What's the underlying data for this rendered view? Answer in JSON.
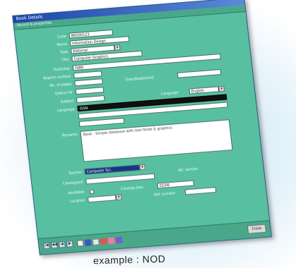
{
  "window": {
    "title": "Book Details",
    "menu_label": "Record & properties"
  },
  "form": {
    "fields": [
      {
        "label": "Code",
        "value": "BK000123"
      },
      {
        "label": "Name",
        "value": "Information Design"
      },
      {
        "label": "Type",
        "value": "Editorial"
      },
      {
        "label": "Title",
        "value": "Computer Graphics"
      },
      {
        "label": "Publisher",
        "value": "ISBN"
      },
      {
        "label": "Reprint number",
        "value": ""
      },
      {
        "label": "No. of pages",
        "value": ""
      },
      {
        "label": "Edition Nr",
        "value": ""
      },
      {
        "label": "Subject",
        "value": ""
      },
      {
        "label": "Language",
        "value": ""
      }
    ],
    "right_labels": {
      "date_label": "Date/Registered",
      "lang_label": "Language",
      "lang_value": "English"
    },
    "dark_field_value": "ISSN",
    "notes_label": "Remarks",
    "notes_value": "Book - Simple database with text fields & graphics",
    "section_label": "Section",
    "section_value": "Computer Sci.",
    "alt_section_label": "Alt. section",
    "catalog_label": "Catalogued",
    "catalog_value": "Catalog date",
    "availability_label": "Available",
    "availability_date": "02/06",
    "location_label": "Location",
    "ref_label": "Ref. number"
  },
  "toolbar": {
    "nav": [
      "|◀",
      "◀◀",
      "◀",
      "▶"
    ],
    "close_label": "Close"
  },
  "caption": "example : NOD"
}
